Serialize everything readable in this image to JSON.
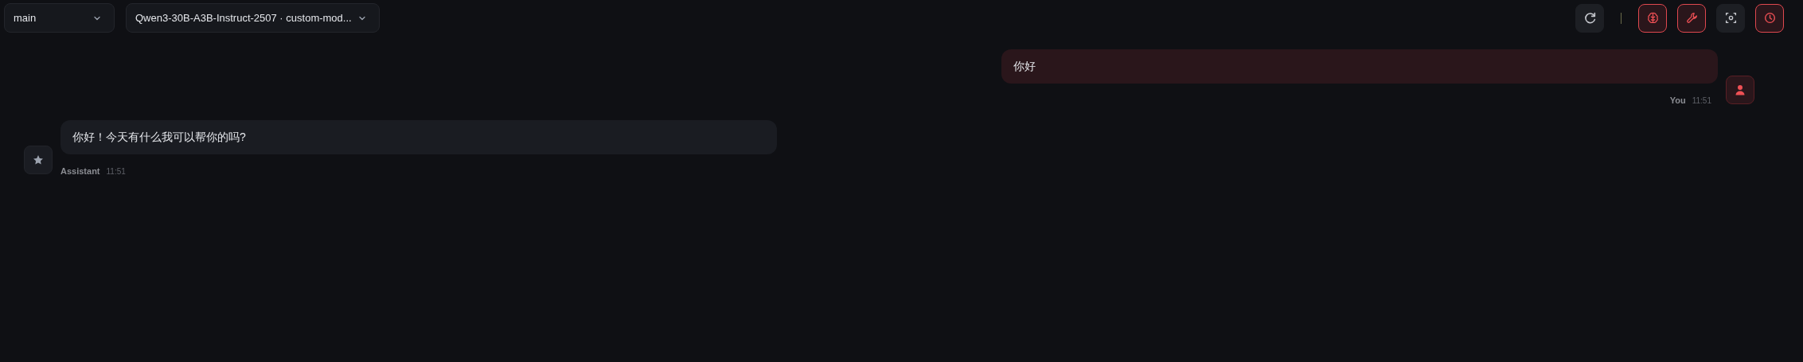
{
  "selectors": [
    {
      "kind": "branch",
      "value": "main"
    },
    {
      "kind": "model",
      "value": "Qwen3-30B-A3B-Instruct-2507 · custom-mod..."
    }
  ],
  "toolbar": [
    {
      "kind": "refresh",
      "on": false
    },
    {
      "kind": "separator"
    },
    {
      "kind": "brain",
      "on": true
    },
    {
      "kind": "wrench",
      "on": true
    },
    {
      "kind": "focus",
      "on": false
    },
    {
      "kind": "clock",
      "on": true
    }
  ],
  "messages": [
    {
      "kind": "user",
      "text": "你好",
      "author": "You",
      "time": "11:51"
    },
    {
      "kind": "assistant",
      "text": "你好！今天有什么我可以帮你的吗?",
      "author": "Assistant",
      "time": "11:51"
    }
  ]
}
